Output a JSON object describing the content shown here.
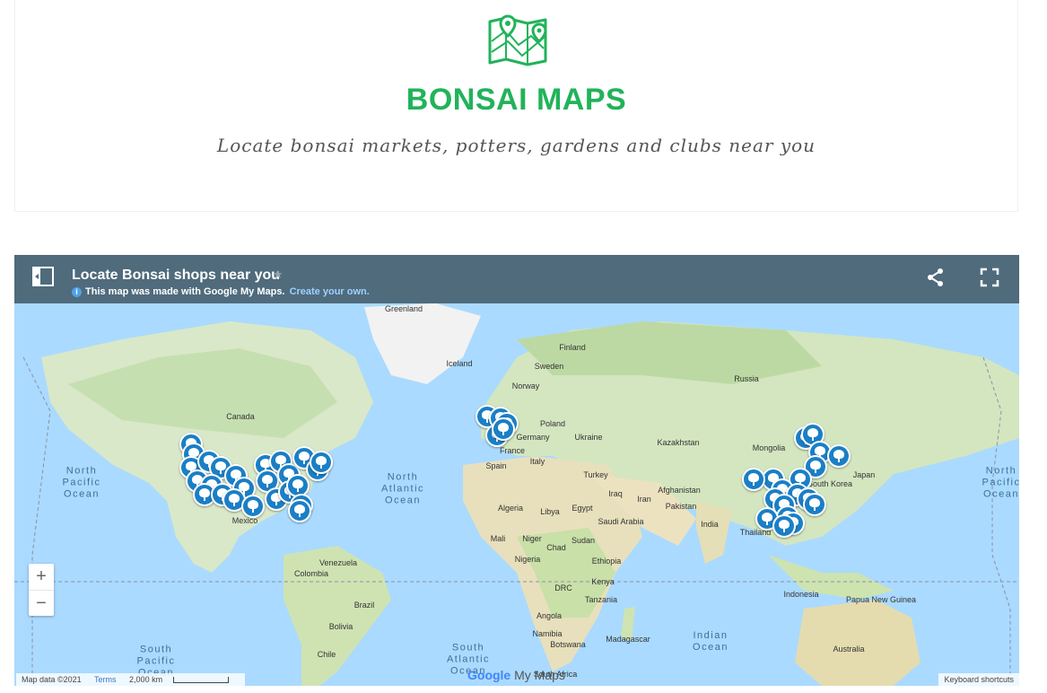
{
  "hero": {
    "title": "BONSAI MAPS",
    "subtitle": "Locate bonsai markets, potters, gardens and clubs near you",
    "logo_icon": "map-pin-icon",
    "accent_color": "#21b35a"
  },
  "map": {
    "title": "Locate Bonsai shops near you",
    "note": "This map was made with Google My Maps.",
    "note_link": "Create your own.",
    "zoom_in": "+",
    "zoom_out": "−",
    "attribution": "Map data ©2021",
    "terms": "Terms",
    "scale": "2,000 km",
    "shortcuts": "Keyboard shortcuts",
    "brand_google": "Google",
    "brand_mymaps": "My Maps",
    "header_color": "#4f6b7c",
    "pin_color": "#1a7fc6",
    "places": [
      "Greenland",
      "Iceland",
      "Finland",
      "Sweden",
      "Norway",
      "Russia",
      "Canada",
      "Poland",
      "Germany",
      "Ukraine",
      "France",
      "Kazakhstan",
      "Mongolia",
      "Spain",
      "Italy",
      "Turkey",
      "Japan",
      "South Korea",
      "Afghanistan",
      "Iraq",
      "Iran",
      "Pakistan",
      "Egypt",
      "Algeria",
      "Libya",
      "Saudi Arabia",
      "India",
      "Thailand",
      "Mexico",
      "Mali",
      "Niger",
      "Chad",
      "Sudan",
      "Ethiopia",
      "Nigeria",
      "Venezuela",
      "Colombia",
      "DRC",
      "Kenya",
      "Tanzania",
      "Indonesia",
      "Papua New Guinea",
      "Angola",
      "Brazil",
      "Bolivia",
      "Namibia",
      "Botswana",
      "Madagascar",
      "Australia",
      "South Africa",
      "Chile"
    ],
    "oceans": [
      "North Pacific Ocean",
      "North Atlantic Ocean",
      "North Pacific Ocean",
      "South Pacific Ocean",
      "South Atlantic Ocean",
      "Indian Ocean"
    ]
  }
}
